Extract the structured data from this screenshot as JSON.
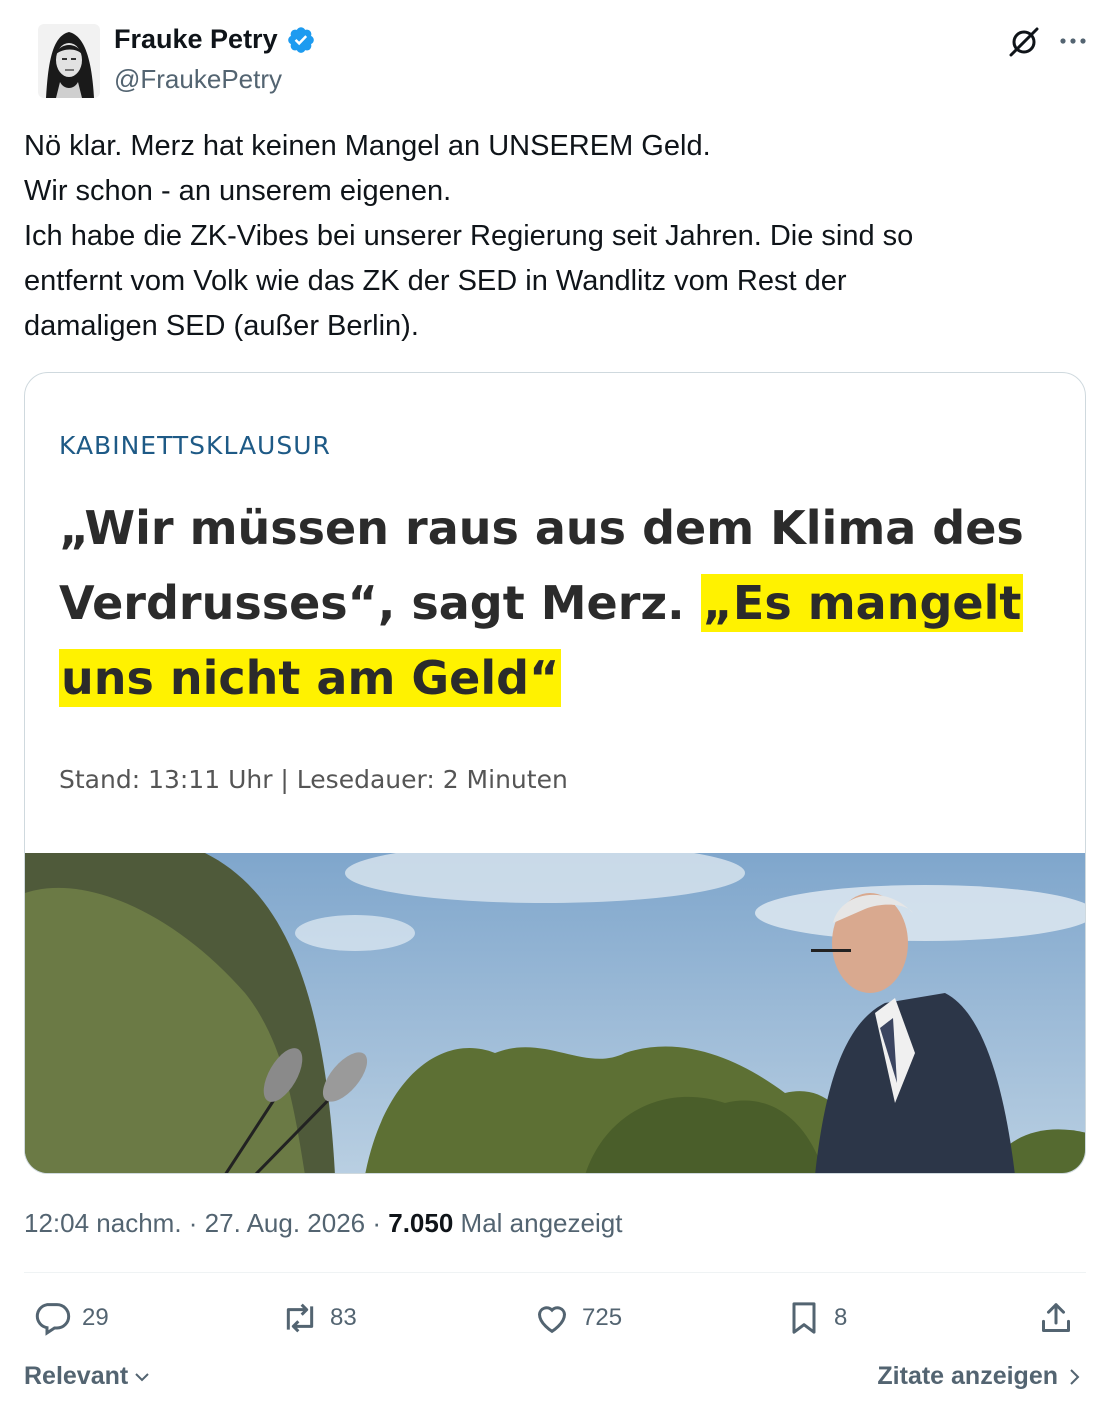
{
  "author": {
    "display_name": "Frauke Petry",
    "handle": "@FraukePetry",
    "verified": true
  },
  "tweet": {
    "lines": [
      "Nö klar. Merz hat keinen Mangel an UNSEREM Geld.",
      "Wir schon - an unserem eigenen.",
      "Ich habe die ZK-Vibes bei unserer Regierung seit Jahren. Die sind so",
      "entfernt vom Volk wie das ZK der SED in Wandlitz vom Rest der",
      "damaligen SED (außer Berlin)."
    ]
  },
  "card": {
    "kicker": "KABINETTSKLAUSUR",
    "headline_plain": "„Wir müssen raus aus dem Klima des Verdrusses“, sagt Merz. ",
    "headline_highlight": "„Es mangelt uns nicht am Geld“",
    "meta": "Stand: 13:11 Uhr  |  Lesedauer: 2 Minuten"
  },
  "meta": {
    "time_date": "12:04 nachm. · 27. Aug. 2026 · ",
    "views": "7.050",
    "views_label": " Mal angezeigt"
  },
  "actions": {
    "replies": "29",
    "reposts": "83",
    "likes": "725",
    "bookmarks": "8"
  },
  "footer": {
    "sort_label": "Relevant",
    "quotes_label": "Zitate anzeigen"
  },
  "colors": {
    "accent": "#1d9bf0",
    "highlight": "#fff200",
    "muted": "#536471",
    "kicker": "#1e5a86"
  }
}
